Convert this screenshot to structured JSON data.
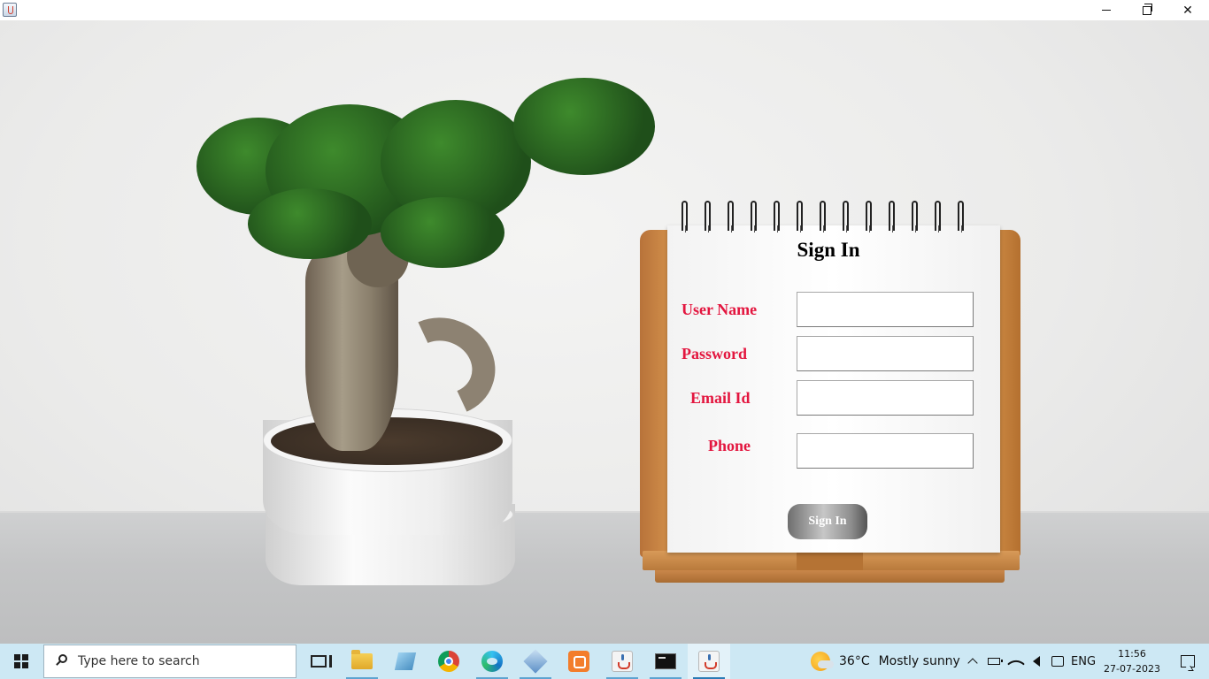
{
  "window": {
    "controls": {
      "minimize": "minimize",
      "maximize": "maximize",
      "close": "close"
    }
  },
  "form": {
    "title": "Sign In",
    "labels": {
      "username": "User Name",
      "password": "Password",
      "email": "Email Id",
      "phone": "Phone"
    },
    "values": {
      "username": "",
      "password": "",
      "email": "",
      "phone": ""
    },
    "submit_label": "Sign In"
  },
  "taskbar": {
    "search_placeholder": "Type here to search",
    "apps": [
      {
        "name": "task-view",
        "icon": "task-view-icon"
      },
      {
        "name": "file-explorer",
        "icon": "folder-icon"
      },
      {
        "name": "notepad",
        "icon": "notepad-icon"
      },
      {
        "name": "chrome",
        "icon": "chrome-icon"
      },
      {
        "name": "edge",
        "icon": "edge-icon"
      },
      {
        "name": "virtualbox",
        "icon": "cube-icon"
      },
      {
        "name": "xampp",
        "icon": "xampp-icon"
      },
      {
        "name": "java",
        "icon": "java-icon"
      },
      {
        "name": "terminal",
        "icon": "terminal-icon"
      },
      {
        "name": "java-active",
        "icon": "java-icon"
      }
    ],
    "weather": {
      "temp": "36°C",
      "condition": "Mostly sunny"
    },
    "language": "ENG",
    "time": "11:56",
    "date": "27-07-2023"
  },
  "colors": {
    "label": "#e3163f",
    "taskbar": "#cde8f4",
    "wood": "#c98541"
  }
}
